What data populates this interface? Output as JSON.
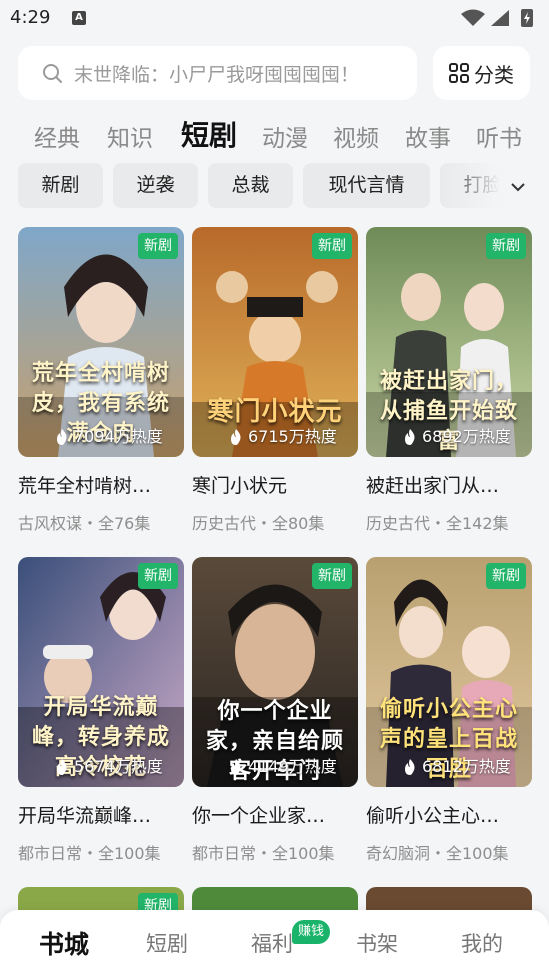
{
  "status": {
    "time": "4:29",
    "notif_icon": "A"
  },
  "search": {
    "placeholder": "末世降临：小尸尸我呀囤囤囤囤！",
    "category_label": "分类"
  },
  "main_tabs": [
    {
      "label": "经典"
    },
    {
      "label": "知识"
    },
    {
      "label": "短剧",
      "active": true
    },
    {
      "label": "动漫"
    },
    {
      "label": "视频"
    },
    {
      "label": "故事"
    },
    {
      "label": "听书"
    }
  ],
  "chips": [
    {
      "label": "新剧"
    },
    {
      "label": "逆袭"
    },
    {
      "label": "总裁"
    },
    {
      "label": "现代言情"
    },
    {
      "label": "打脸"
    }
  ],
  "cards": [
    {
      "badge": "新剧",
      "heat": "7094万热度",
      "poster_text": "荒年全村啃树皮，我有系统满仓肉",
      "title": "荒年全村啃树…",
      "subtitle": "古风权谋・全76集",
      "colors": [
        "#7fa7c9",
        "#c9a06a"
      ]
    },
    {
      "badge": "新剧",
      "heat": "6715万热度",
      "poster_text": "寒门小状元",
      "title": "寒门小状元",
      "subtitle": "历史古代・全80集",
      "colors": [
        "#b86a2a",
        "#e0b25a"
      ]
    },
    {
      "badge": "新剧",
      "heat": "6892万热度",
      "poster_text": "被赶出家门，从捕鱼开始致富",
      "title": "被赶出家门从…",
      "subtitle": "历史古代・全142集",
      "colors": [
        "#6f8b58",
        "#c9d7a5"
      ]
    },
    {
      "badge": "新剧",
      "heat": "5674万热度",
      "poster_text": "开局华流巅峰，转身养成高冷校花",
      "title": "开局华流巅峰…",
      "subtitle": "都市日常・全100集",
      "colors": [
        "#3a4f7a",
        "#c9a9c7"
      ]
    },
    {
      "badge": "新剧",
      "heat": "4149万热度",
      "poster_text": "你一个企业家，亲自给顾客开车门",
      "title": "你一个企业家…",
      "subtitle": "都市日常・全100集",
      "colors": [
        "#5a4a3a",
        "#2a2522"
      ]
    },
    {
      "badge": "新剧",
      "heat": "6812万热度",
      "poster_text": "偷听小公主心声的皇上百战百胜",
      "title": "偷听小公主心…",
      "subtitle": "奇幻脑洞・全100集",
      "colors": [
        "#b8a070",
        "#e3c9a0"
      ]
    },
    {
      "badge": "新剧",
      "colors": [
        "#8aa848",
        "#6d8a3a"
      ]
    },
    {
      "badge": "",
      "colors": [
        "#4f8a3a",
        "#a9c97a"
      ]
    },
    {
      "badge": "",
      "colors": [
        "#7a5a3a",
        "#3a2a1e"
      ]
    }
  ],
  "bottom_nav": [
    {
      "label": "书城",
      "active": true
    },
    {
      "label": "短剧"
    },
    {
      "label": "福利"
    },
    {
      "label": "书架"
    },
    {
      "label": "我的"
    }
  ],
  "nav_badge": "赚钱",
  "colors": {
    "accent_green": "#22b468",
    "background": "#f4f5f7"
  }
}
